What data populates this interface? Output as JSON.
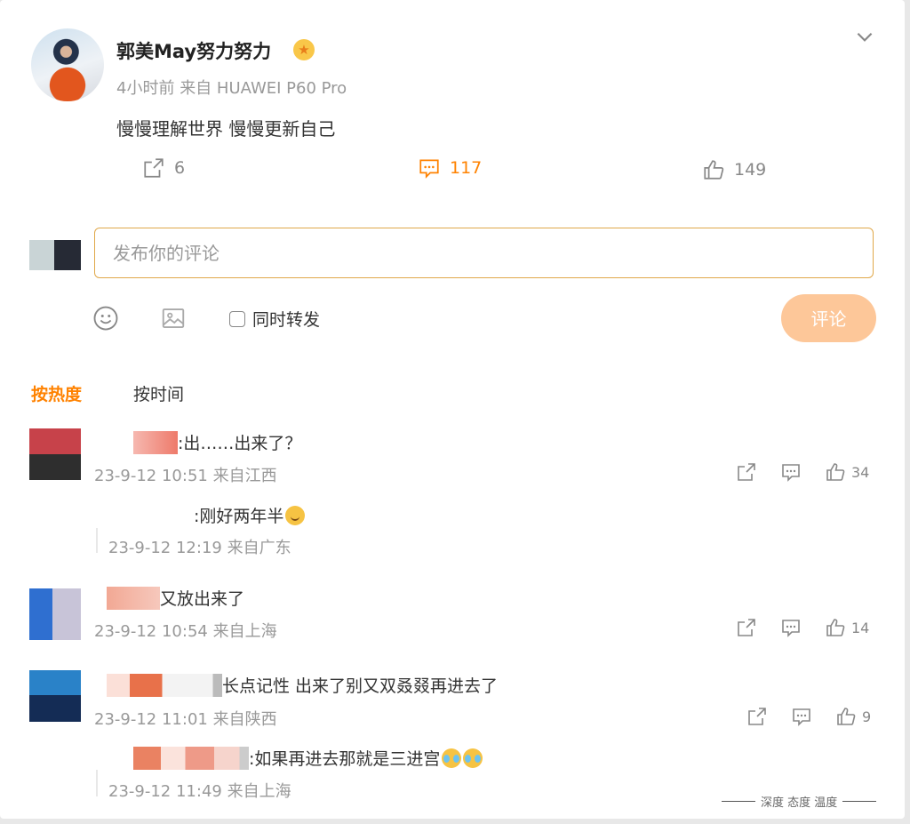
{
  "post": {
    "username": "郭美May努力努力",
    "time": "4小时前",
    "source": "来自 HUAWEI P60 Pro",
    "text": "慢慢理解世界 慢慢更新自己",
    "repost_count": "6",
    "comment_count": "117",
    "like_count": "149"
  },
  "composer": {
    "placeholder": "发布你的评论",
    "repost_label": "同时转发",
    "submit_label": "评论"
  },
  "sort": {
    "hot": "按热度",
    "time": "按时间"
  },
  "comments": [
    {
      "text": ":出……出来了？",
      "time": "23-9-12 10:51",
      "location": "来自江西",
      "likes": "34"
    },
    {
      "text": ":刚好两年半",
      "time": "23-9-12 12:19",
      "location": "来自广东",
      "is_reply": true
    },
    {
      "text": "又放出来了",
      "time": "23-9-12 10:54",
      "location": "来自上海",
      "likes": "14"
    },
    {
      "text": "长点记性 出来了别又双叒叕再进去了",
      "time": "23-9-12 11:01",
      "location": "来自陕西",
      "likes": "9"
    },
    {
      "text": ":如果再进去那就是三进宫",
      "time": "23-9-12 11:49",
      "location": "来自上海",
      "is_reply": true
    }
  ],
  "watermark": "深度 态度 温度",
  "colors": {
    "accent": "#ff8200",
    "button": "#fdc799",
    "input_border": "#e0a84a"
  }
}
